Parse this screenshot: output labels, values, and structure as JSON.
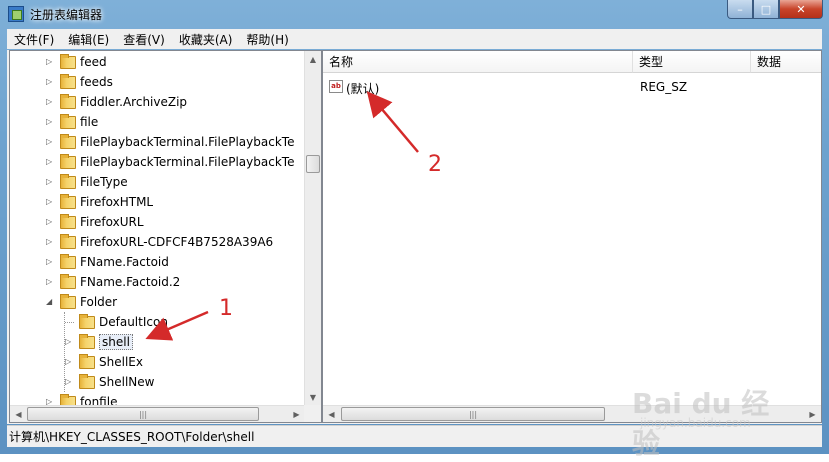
{
  "window": {
    "title": "注册表编辑器"
  },
  "titlebar_buttons": {
    "minimize": "–",
    "maximize": "□",
    "close": "✕"
  },
  "menu": [
    "文件(F)",
    "编辑(E)",
    "查看(V)",
    "收藏夹(A)",
    "帮助(H)"
  ],
  "tree": {
    "items": [
      {
        "label": "feed",
        "level": 0,
        "expander": "▷"
      },
      {
        "label": "feeds",
        "level": 0,
        "expander": "▷"
      },
      {
        "label": "Fiddler.ArchiveZip",
        "level": 0,
        "expander": "▷"
      },
      {
        "label": "file",
        "level": 0,
        "expander": "▷"
      },
      {
        "label": "FilePlaybackTerminal.FilePlaybackTe",
        "level": 0,
        "expander": "▷"
      },
      {
        "label": "FilePlaybackTerminal.FilePlaybackTe",
        "level": 0,
        "expander": "▷"
      },
      {
        "label": "FileType",
        "level": 0,
        "expander": "▷"
      },
      {
        "label": "FirefoxHTML",
        "level": 0,
        "expander": "▷"
      },
      {
        "label": "FirefoxURL",
        "level": 0,
        "expander": "▷"
      },
      {
        "label": "FirefoxURL-CDFCF4B7528A39A6",
        "level": 0,
        "expander": "▷"
      },
      {
        "label": "FName.Factoid",
        "level": 0,
        "expander": "▷"
      },
      {
        "label": "FName.Factoid.2",
        "level": 0,
        "expander": "▷"
      },
      {
        "label": "Folder",
        "level": 0,
        "expander": "◢"
      },
      {
        "label": "DefaultIcon",
        "level": 1,
        "expander": ""
      },
      {
        "label": "shell",
        "level": 1,
        "expander": "▷",
        "selected": true
      },
      {
        "label": "ShellEx",
        "level": 1,
        "expander": "▷"
      },
      {
        "label": "ShellNew",
        "level": 1,
        "expander": "▷"
      },
      {
        "label": "fonfile",
        "level": 0,
        "expander": "▷"
      }
    ]
  },
  "scroll_glyphs": {
    "up": "▲",
    "down": "▼",
    "left": "◀",
    "right": "▶",
    "grip": "|||"
  },
  "values_pane": {
    "columns": {
      "name": "名称",
      "type": "类型",
      "data": "数据"
    },
    "rows": [
      {
        "icon": "ab",
        "name": "(默认)",
        "type": "REG_SZ",
        "data": ""
      }
    ]
  },
  "status": {
    "path": "计算机\\HKEY_CLASSES_ROOT\\Folder\\shell"
  },
  "annotations": {
    "label1": "1",
    "label2": "2",
    "color": "#d42a2a"
  },
  "watermark": {
    "main": "Bai du 经验",
    "sub": "jingyan.baidu.com"
  }
}
